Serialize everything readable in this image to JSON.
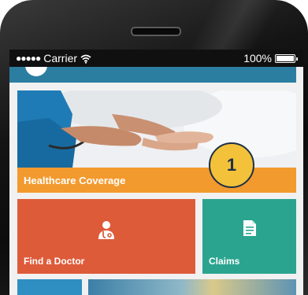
{
  "status_bar": {
    "carrier": "Carrier",
    "signal_dots": "●●●●●",
    "battery_percent": "100%",
    "battery_level": 1.0
  },
  "hero": {
    "label": "Healthcare Coverage",
    "badge_number": "1"
  },
  "tiles": {
    "doctor_label": "Find a Doctor",
    "claims_label": "Claims"
  },
  "colors": {
    "status_bar_bg": "#101010",
    "top_bar": "#2c7ea1",
    "hero_label_bar": "#f39a2e",
    "badge_fill": "#f3c23a",
    "doctor_tile": "#de5b3a",
    "claims_tile": "#2aa48f",
    "blue_tile": "#2f8ec2"
  },
  "icons": {
    "wifi": "wifi-icon",
    "battery": "battery-icon",
    "doctor": "doctor-icon",
    "claims": "document-icon",
    "avatar": "user-avatar-icon"
  }
}
